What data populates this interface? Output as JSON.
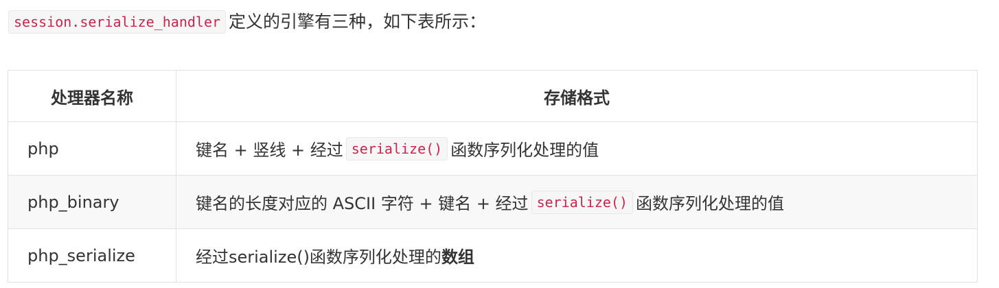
{
  "intro": {
    "code": "session.serialize_handler",
    "text": "定义的引擎有三种，如下表所示："
  },
  "table": {
    "headers": [
      "处理器名称",
      "存储格式"
    ],
    "rows": [
      {
        "name": "php",
        "format_before": "键名 + 竖线 + 经过",
        "format_code": "serialize()",
        "format_after": "函数序列化处理的值"
      },
      {
        "name": "php_binary",
        "format_before": "键名的长度对应的 ASCII 字符 + 键名 + 经过",
        "format_code": "serialize()",
        "format_after": "函数序列化处理的值"
      },
      {
        "name": "php_serialize",
        "format_before": "经过serialize()函数序列化处理的",
        "format_bold": "数组"
      }
    ]
  }
}
